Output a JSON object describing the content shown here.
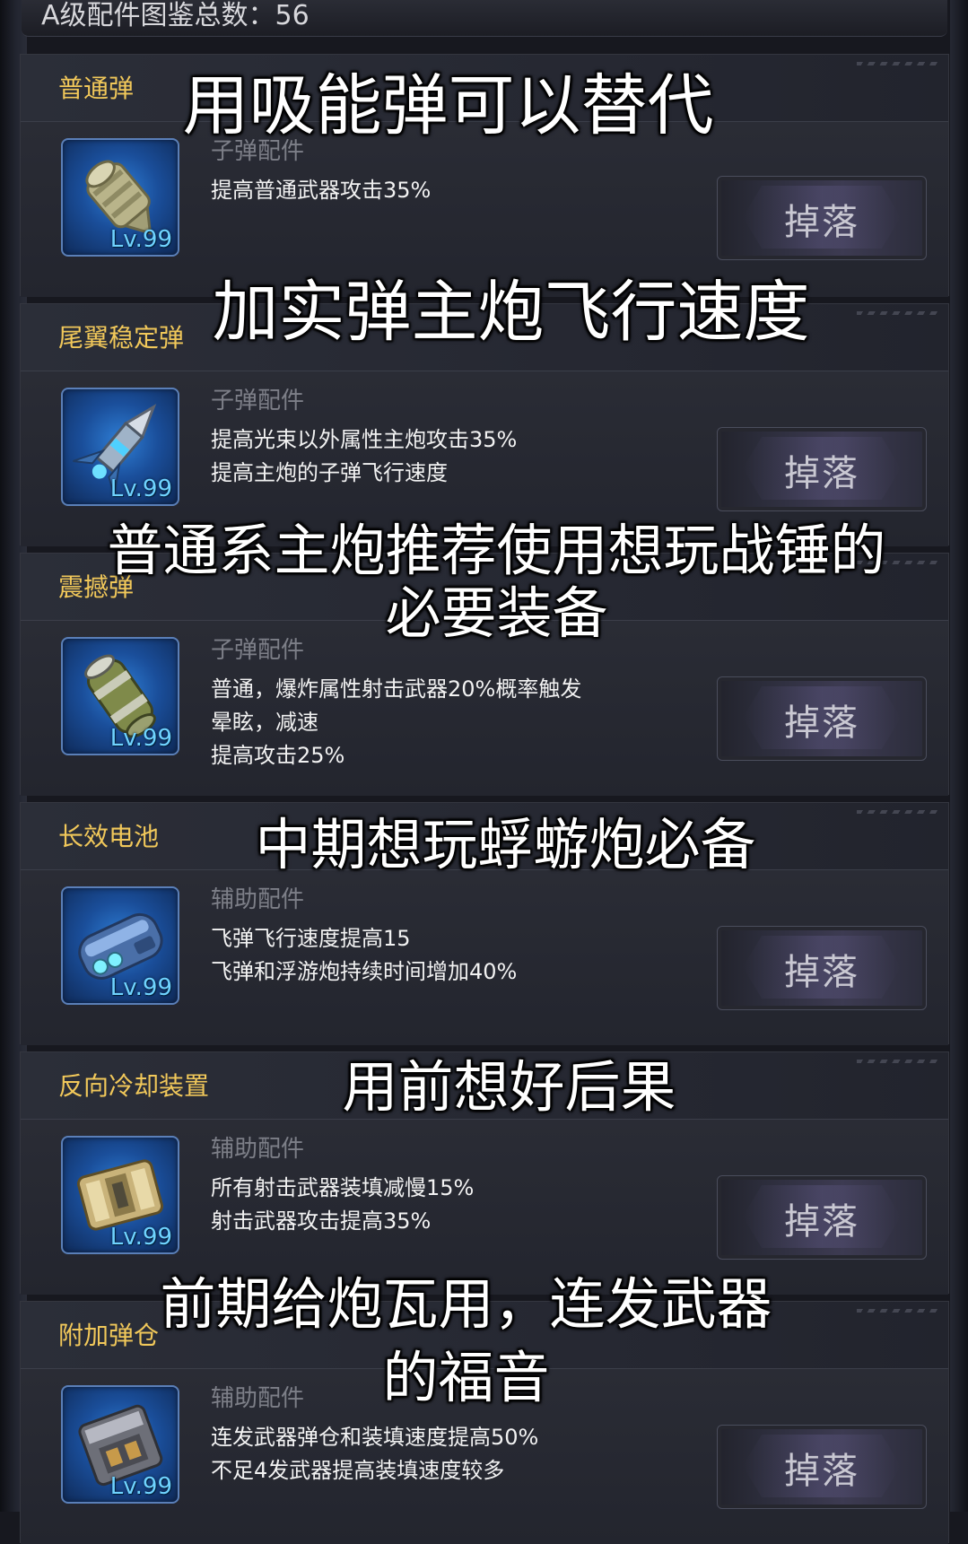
{
  "header": {
    "summary": "A级配件图鉴总数：56"
  },
  "cards": [
    {
      "name": "普通弹",
      "category": "子弹配件",
      "level": "Lv.99",
      "lines": [
        "提高普通武器攻击35%"
      ],
      "button": "掉落",
      "icon": "normal-bullet-icon"
    },
    {
      "name": "尾翼稳定弹",
      "category": "子弹配件",
      "level": "Lv.99",
      "lines": [
        "提高光束以外属性主炮攻击35%",
        "提高主炮的子弹飞行速度"
      ],
      "button": "掉落",
      "icon": "fin-stabilized-bullet-icon"
    },
    {
      "name": "震撼弹",
      "category": "子弹配件",
      "level": "Lv.99",
      "lines": [
        "普通，爆炸属性射击武器20%概率触发",
        "晕眩，减速",
        "提高攻击25%"
      ],
      "button": "掉落",
      "icon": "shock-bullet-icon"
    },
    {
      "name": "长效电池",
      "category": "辅助配件",
      "level": "Lv.99",
      "lines": [
        "飞弹飞行速度提高15",
        "飞弹和浮游炮持续时间增加40%"
      ],
      "button": "掉落",
      "icon": "battery-icon"
    },
    {
      "name": "反向冷却装置",
      "category": "辅助配件",
      "level": "Lv.99",
      "lines": [
        "所有射击武器装填减慢15%",
        "射击武器攻击提高35%"
      ],
      "button": "掉落",
      "icon": "cooling-device-icon"
    },
    {
      "name": "附加弹仓",
      "category": "辅助配件",
      "level": "Lv.99",
      "lines": [
        "连发武器弹仓和装填速度提高50%",
        "不足4发武器提高装填速度较多"
      ],
      "button": "掉落",
      "icon": "extra-magazine-icon"
    }
  ],
  "captions": [
    "用吸能弹可以替代",
    "加实弹主炮飞行速度",
    "普通系主炮推荐使用想玩战锤的",
    "必要装备",
    "中期想玩蜉蝣炮必备",
    "用前想好后果",
    "前期给炮瓦用，连发武器",
    "的福音"
  ]
}
